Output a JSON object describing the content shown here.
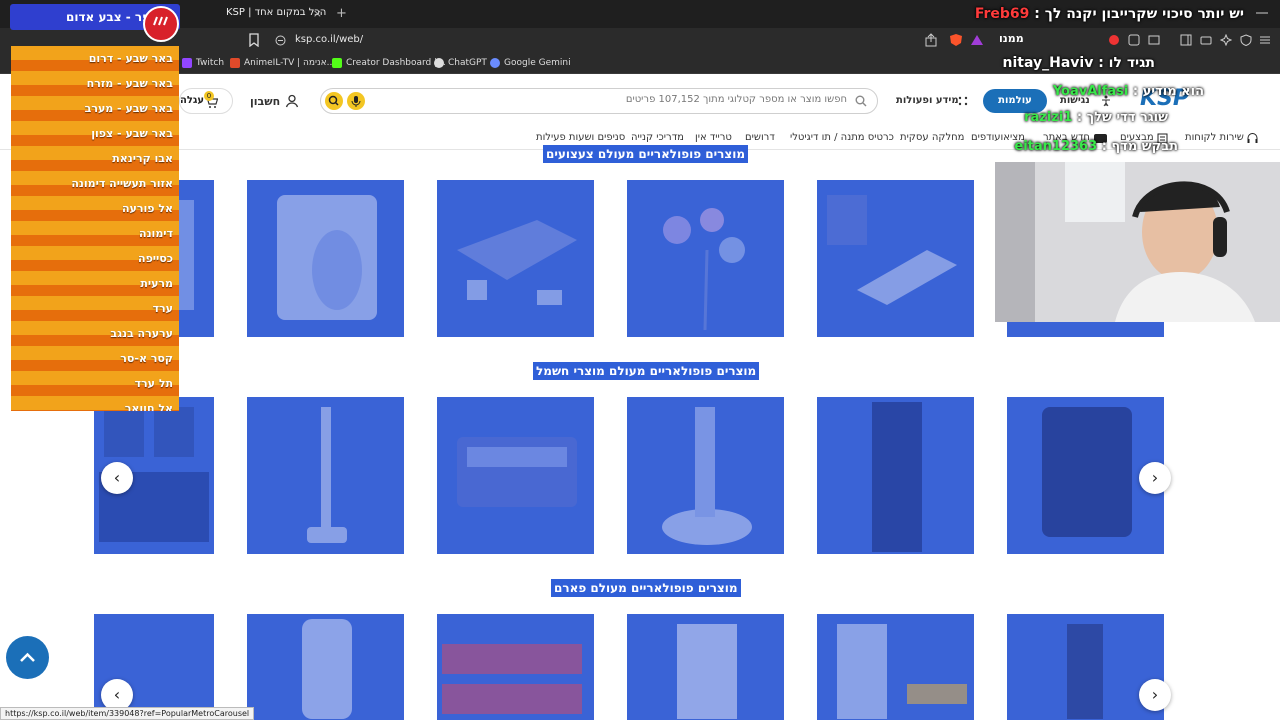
{
  "browser": {
    "tabs": [
      {
        "title": "KSP | הכל במקום אחד",
        "active": true
      },
      {
        "title": "",
        "active": false
      }
    ],
    "new_tab": "+",
    "close_tab": "×",
    "url": "ksp.co.il/web/",
    "profile_label": "ממנו",
    "bookmarks": [
      "Twitch",
      "AnimeIL-TV | אנימה...",
      "Creator Dashboard |...",
      "ChatGPT",
      "Google Gemini"
    ],
    "status_url": "https://ksp.co.il/web/item/339048?ref=PopularMetroCarousel"
  },
  "site": {
    "logo": "KSP",
    "search_placeholder": "חפשו מוצר או מספר קטלוגי מתוך 107,152 פריטים",
    "header_links": {
      "info": "מידע ופעולות",
      "accessibility": "נגישות",
      "world": "עולמות",
      "account": "חשבון",
      "cart": "עגלה",
      "cart_count": "0"
    },
    "nav": [
      "שירות לקוחות",
      "מבצעים",
      "חדש באתר",
      "מציאועודפים",
      "מחלקה עסקית",
      "כרטיס מתנה / תו דיגיטלי",
      "דרושים",
      "טרייד אין",
      "מדריכי קנייה",
      "סניפים ושעות פעילות"
    ],
    "sections": [
      {
        "title": "מוצרים פופולאריים מעולם צעצועים"
      },
      {
        "title": "מוצרים פופולאריים מעולם מוצרי חשמל"
      },
      {
        "title": "מוצרים פופולאריים מעולם פארם"
      }
    ],
    "arrows": {
      "prev": "‹",
      "next": "›"
    },
    "scroll_top": "^"
  },
  "overlay": {
    "alert_title": "צופר - צבע אדום",
    "alert_locations": [
      "באר שבע - דרום",
      "באר שבע - מזרח",
      "באר שבע - מערב",
      "באר שבע - צפון",
      "אבו קרינאת",
      "אזור תעשייה דימונה",
      "אל פורעה",
      "דימונה",
      "כסייפה",
      "מרעית",
      "ערד",
      "ערערה בנגב",
      "קסר א-סר",
      "תל ערד",
      "אל חוואר"
    ],
    "chat": [
      {
        "text": "יש יותר סיכוי שקרייבון יקנה לך :",
        "user": "Freb69",
        "color": "red"
      },
      {
        "text": "תגיד לו :",
        "user": "nitay_Haviv",
        "color": "white"
      },
      {
        "text": "הוא מודיע :",
        "user": "YoavAlfasi",
        "color": "green"
      },
      {
        "text": "שוגר דדי שלך :",
        "user": "razizi1",
        "color": "green"
      },
      {
        "text": "תבקש מדף :",
        "user": "eitan12363",
        "color": "green"
      }
    ]
  },
  "colors": {
    "accent_blue": "#2f5fd8",
    "overlay_orange": "#f2a31b",
    "ksp_blue": "#1b6fb8"
  }
}
